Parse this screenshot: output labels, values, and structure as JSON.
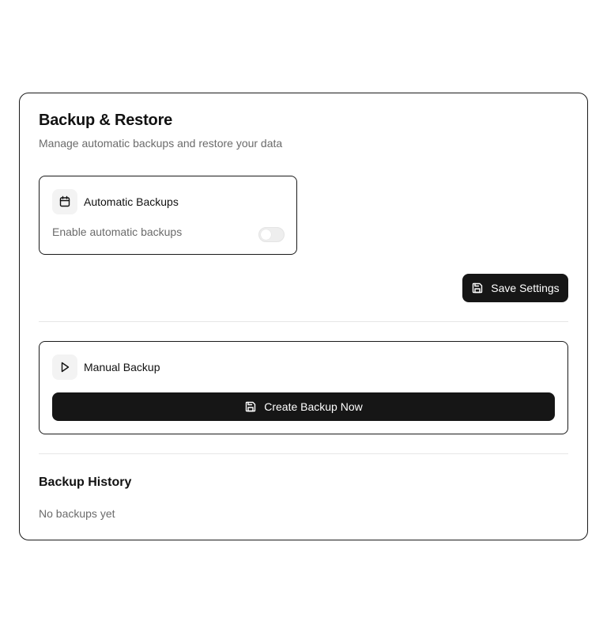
{
  "header": {
    "title": "Backup & Restore",
    "subtitle": "Manage automatic backups and restore your data"
  },
  "automatic": {
    "title": "Automatic Backups",
    "icon": "calendar-icon",
    "enable_label": "Enable automatic backups",
    "enabled": false
  },
  "actions": {
    "save_label": "Save Settings",
    "save_icon": "save-icon"
  },
  "manual": {
    "title": "Manual Backup",
    "icon": "play-icon",
    "create_label": "Create Backup Now",
    "create_icon": "save-icon"
  },
  "history": {
    "title": "Backup History",
    "empty_text": "No backups yet"
  },
  "colors": {
    "primary_button": "#161616",
    "muted_text": "#6b6b6b",
    "border": "#1a1a1a"
  }
}
